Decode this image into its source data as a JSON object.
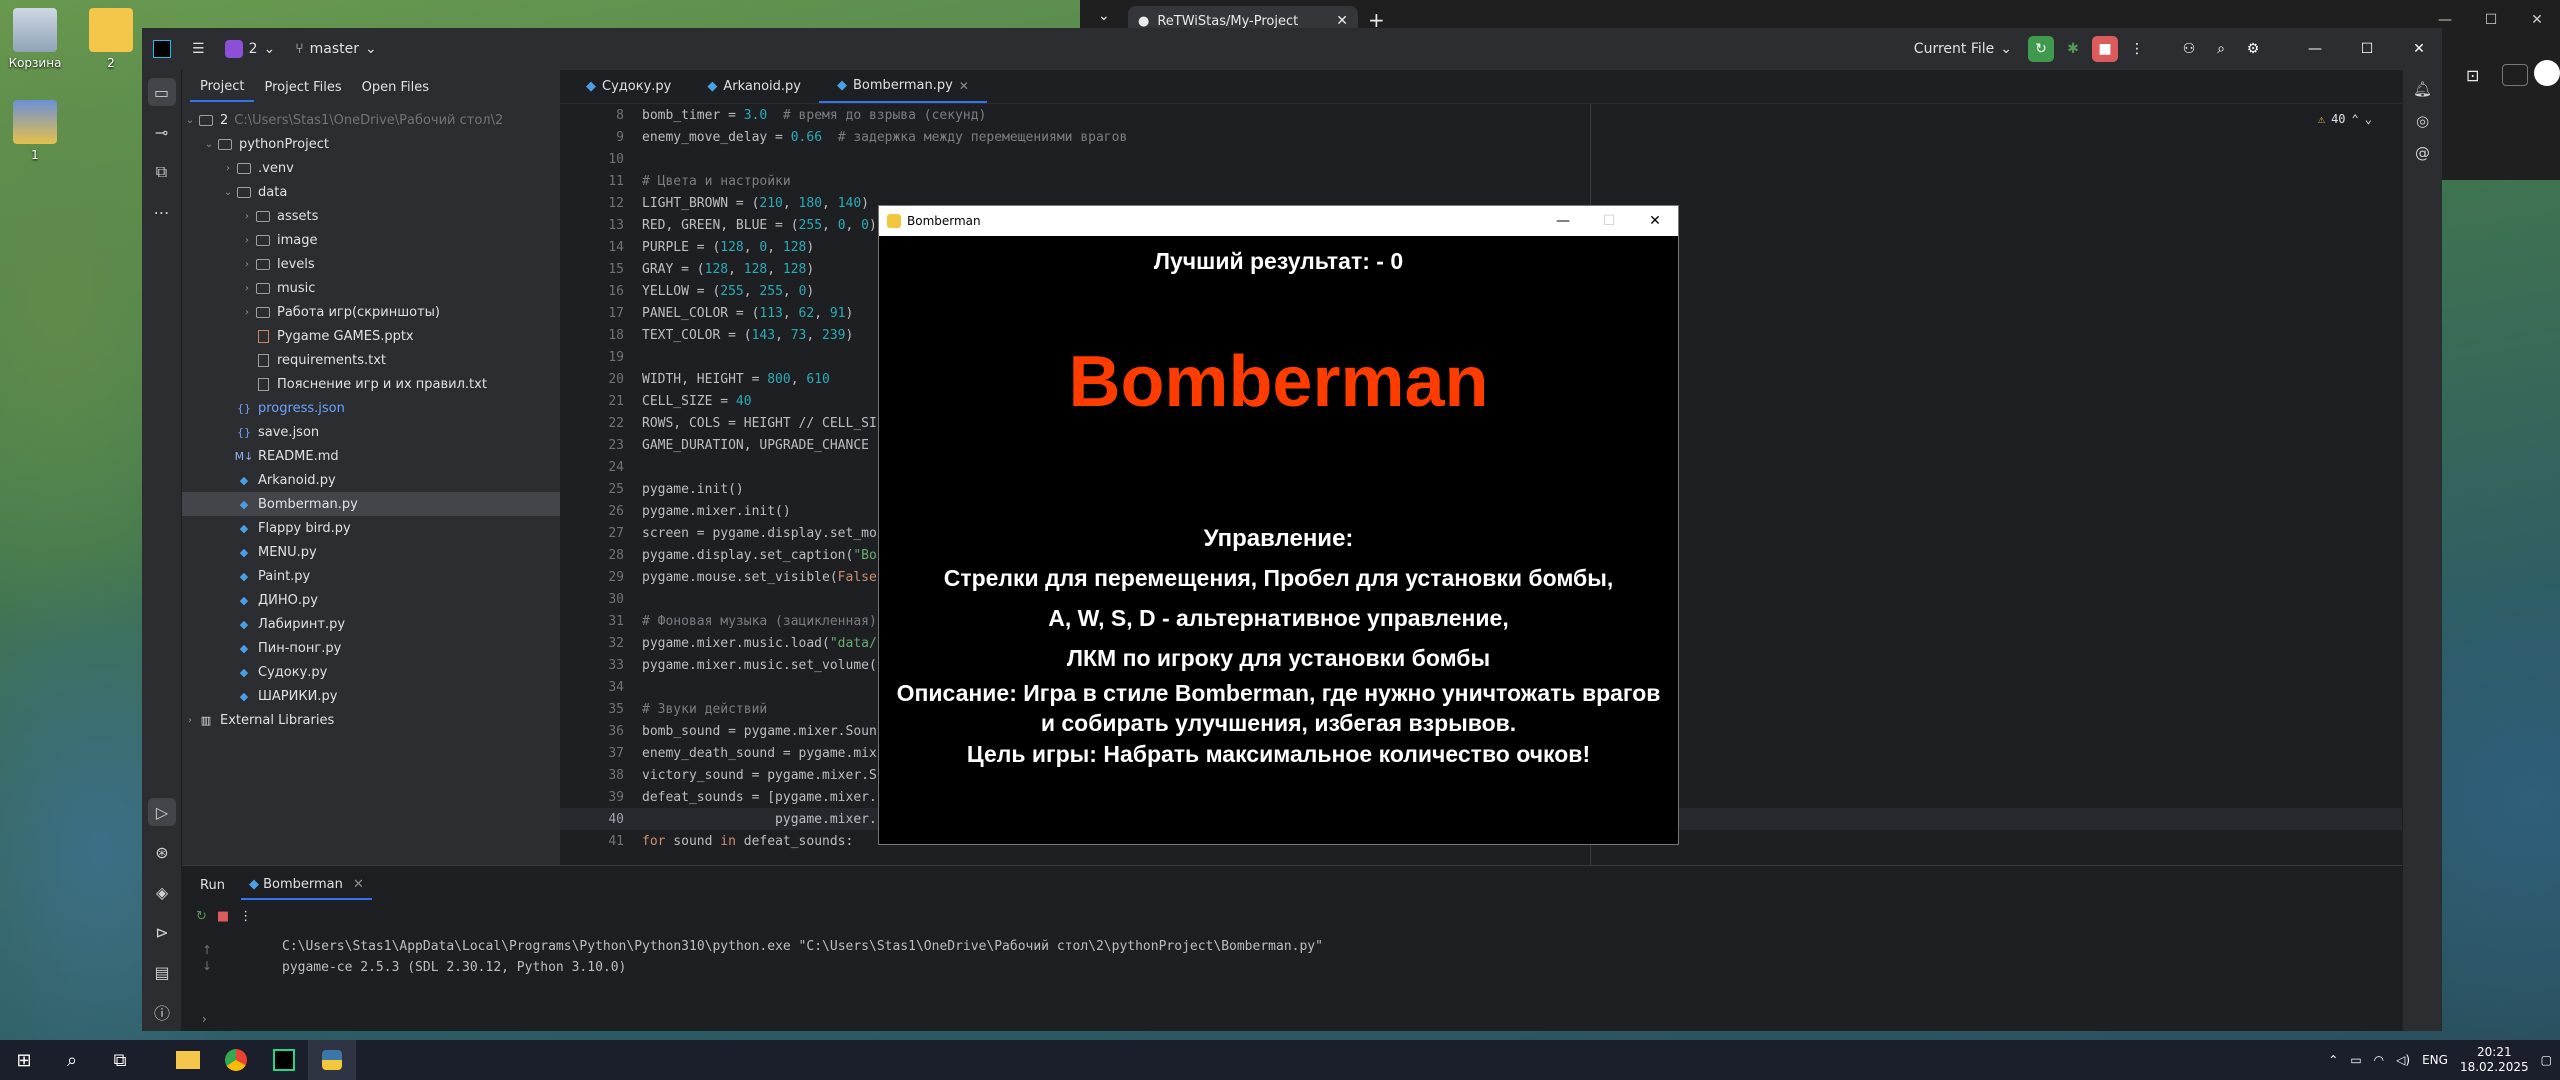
{
  "desktop": {
    "icons": [
      {
        "label": "Корзина"
      },
      {
        "label": "2"
      },
      {
        "label": "1"
      }
    ]
  },
  "browser": {
    "tab_title": "ReTWiStas/My-Project",
    "close": "✕",
    "new_tab": "+"
  },
  "ide": {
    "project_count": "2",
    "branch": "master",
    "run_config": "Current File",
    "panel_tabs": [
      "Project",
      "Project Files",
      "Open Files"
    ],
    "root_name": "2",
    "root_path": "C:\\Users\\Stas1\\OneDrive\\Рабочий стол\\2",
    "tree": [
      {
        "label": "pythonProject",
        "kind": "folder",
        "depth": 1,
        "open": true
      },
      {
        "label": ".venv",
        "kind": "folder",
        "depth": 2,
        "open": false
      },
      {
        "label": "data",
        "kind": "folder",
        "depth": 2,
        "open": true
      },
      {
        "label": "assets",
        "kind": "folder",
        "depth": 3,
        "open": false
      },
      {
        "label": "image",
        "kind": "folder",
        "depth": 3,
        "open": false
      },
      {
        "label": "levels",
        "kind": "folder",
        "depth": 3,
        "open": false
      },
      {
        "label": "music",
        "kind": "folder",
        "depth": 3,
        "open": false
      },
      {
        "label": "Работа игр(скриншоты)",
        "kind": "folder",
        "depth": 3,
        "open": false
      },
      {
        "label": "Pygame GAMES.pptx",
        "kind": "file",
        "depth": 3
      },
      {
        "label": "requirements.txt",
        "kind": "txt",
        "depth": 3
      },
      {
        "label": "Пояснение игр и их правил.txt",
        "kind": "txt",
        "depth": 3
      },
      {
        "label": "progress.json",
        "kind": "json",
        "depth": 2
      },
      {
        "label": "save.json",
        "kind": "json",
        "depth": 2
      },
      {
        "label": "README.md",
        "kind": "md",
        "depth": 2
      },
      {
        "label": "Arkanoid.py",
        "kind": "py",
        "depth": 2
      },
      {
        "label": "Bomberman.py",
        "kind": "py",
        "depth": 2,
        "selected": true
      },
      {
        "label": "Flappy bird.py",
        "kind": "py",
        "depth": 2
      },
      {
        "label": "MENU.py",
        "kind": "py",
        "depth": 2
      },
      {
        "label": "Paint.py",
        "kind": "py",
        "depth": 2
      },
      {
        "label": "ДИНО.py",
        "kind": "py",
        "depth": 2
      },
      {
        "label": "Лабиринт.py",
        "kind": "py",
        "depth": 2
      },
      {
        "label": "Пин-понг.py",
        "kind": "py",
        "depth": 2
      },
      {
        "label": "Судоку.py",
        "kind": "py",
        "depth": 2
      },
      {
        "label": "ШАРИКИ.py",
        "kind": "py",
        "depth": 2
      }
    ],
    "external_libraries": "External Libraries",
    "editor_tabs": [
      {
        "label": "Судоку.py"
      },
      {
        "label": "Arkanoid.py"
      },
      {
        "label": "Bomberman.py",
        "active": true
      }
    ],
    "warnings_count": "40",
    "code_lines": [
      {
        "n": "8",
        "text": "bomb_timer = 3.0  # время до взрыва (секунд)"
      },
      {
        "n": "9",
        "text": "enemy_move_delay = 0.66  # задержка между перемещениями врагов"
      },
      {
        "n": "10",
        "text": ""
      },
      {
        "n": "11",
        "text": "# Цвета и настройки"
      },
      {
        "n": "12",
        "text": "LIGHT_BROWN = (210, 180, 140)"
      },
      {
        "n": "13",
        "text": "RED, GREEN, BLUE = (255, 0, 0)"
      },
      {
        "n": "14",
        "text": "PURPLE = (128, 0, 128)"
      },
      {
        "n": "15",
        "text": "GRAY = (128, 128, 128)"
      },
      {
        "n": "16",
        "text": "YELLOW = (255, 255, 0)"
      },
      {
        "n": "17",
        "text": "PANEL_COLOR = (113, 62, 91)"
      },
      {
        "n": "18",
        "text": "TEXT_COLOR = (143, 73, 239)"
      },
      {
        "n": "19",
        "text": ""
      },
      {
        "n": "20",
        "text": "WIDTH, HEIGHT = 800, 610"
      },
      {
        "n": "21",
        "text": "CELL_SIZE = 40"
      },
      {
        "n": "22",
        "text": "ROWS, COLS = HEIGHT // CELL_SI"
      },
      {
        "n": "23",
        "text": "GAME_DURATION, UPGRADE_CHANCE"
      },
      {
        "n": "24",
        "text": ""
      },
      {
        "n": "25",
        "text": "pygame.init()"
      },
      {
        "n": "26",
        "text": "pygame.mixer.init()"
      },
      {
        "n": "27",
        "text": "screen = pygame.display.set_mo"
      },
      {
        "n": "28",
        "text": "pygame.display.set_caption(\"Bo"
      },
      {
        "n": "29",
        "text": "pygame.mouse.set_visible(False"
      },
      {
        "n": "30",
        "text": ""
      },
      {
        "n": "31",
        "text": "# Фоновая музыка (зацикленная)"
      },
      {
        "n": "32",
        "text": "pygame.mixer.music.load(\"data/"
      },
      {
        "n": "33",
        "text": "pygame.mixer.music.set_volume("
      },
      {
        "n": "34",
        "text": ""
      },
      {
        "n": "35",
        "text": "# Звуки действий"
      },
      {
        "n": "36",
        "text": "bomb_sound = pygame.mixer.Soun"
      },
      {
        "n": "37",
        "text": "enemy_death_sound = pygame.mix"
      },
      {
        "n": "38",
        "text": "victory_sound = pygame.mixer.S"
      },
      {
        "n": "39",
        "text": "defeat_sounds = [pygame.mixer."
      },
      {
        "n": "40",
        "text": "                 pygame.mixer.",
        "current": true
      },
      {
        "n": "41",
        "text": "for sound in defeat_sounds:"
      }
    ],
    "run": {
      "tab_run": "Run",
      "tab_config": "Bomberman",
      "console_lines": [
        "C:\\Users\\Stas1\\AppData\\Local\\Programs\\Python\\Python310\\python.exe \"C:\\Users\\Stas1\\OneDrive\\Рабочий стол\\2\\pythonProject\\Bomberman.py\"",
        "pygame-ce 2.5.3 (SDL 2.30.12, Python 3.10.0)"
      ]
    }
  },
  "game": {
    "window_title": "Bomberman",
    "best_score": "Лучший результат:  - 0",
    "title": "Bomberman",
    "title_color": "#ff3c00",
    "controls_header": "Управление:",
    "controls_1": "Стрелки для перемещения, Пробел для установки бомбы,",
    "controls_2": "A, W, S, D - альтернативное управление,",
    "controls_3": "ЛКМ по игроку для установки бомбы",
    "desc_1": "Описание: Игра в стиле Bomberman, где нужно уничтожать врагов",
    "desc_2": "и собирать улучшения, избегая взрывов.",
    "goal": "Цель игры: Набрать максимальное количество очков!"
  },
  "taskbar": {
    "lang": "ENG",
    "time": "20:21",
    "date": "18.02.2025"
  }
}
